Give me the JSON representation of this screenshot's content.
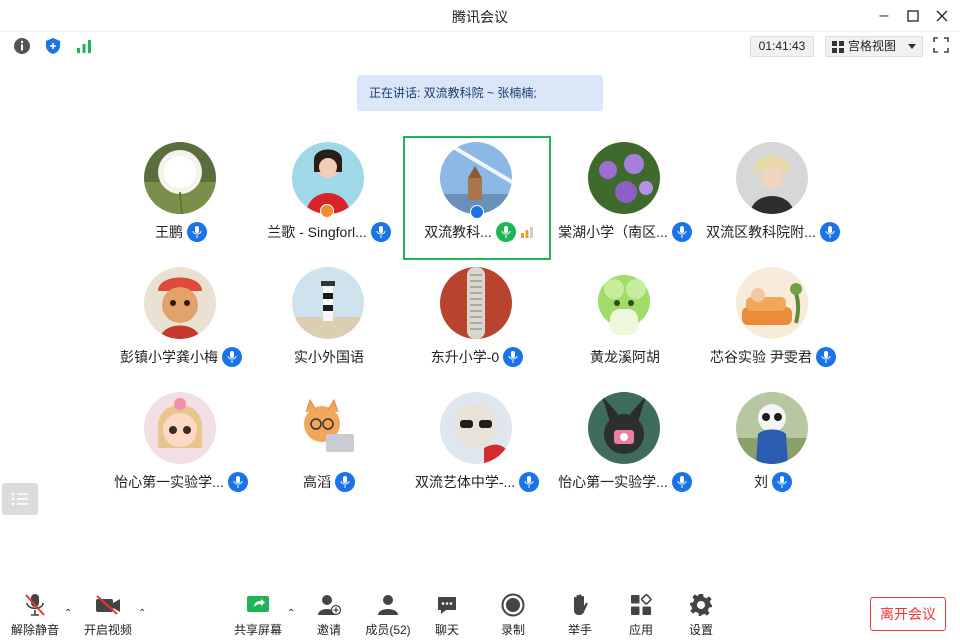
{
  "window": {
    "title": "腾讯会议"
  },
  "toolbar": {
    "timer": "01:41:43",
    "view_label": "宫格视图"
  },
  "banner": {
    "speaking": "正在讲话: 双流教科院 ~ 张楠楠;"
  },
  "participants": [
    {
      "name": "王鹏",
      "avatar": "dandelion",
      "mic": "blue",
      "active": false
    },
    {
      "name": "兰歌 - Singforl...",
      "avatar": "woman-red-dress",
      "mic": "blue",
      "active": false
    },
    {
      "name": "双流教科...",
      "avatar": "tower-sky",
      "mic": "green",
      "active": true
    },
    {
      "name": "棠湖小学（南区...",
      "avatar": "purple-flowers",
      "mic": "blue",
      "active": false
    },
    {
      "name": "双流区教科院附...",
      "avatar": "person-hat",
      "mic": "blue",
      "active": false
    },
    {
      "name": "彭镇小学龚小梅",
      "avatar": "cat-costume",
      "mic": "blue",
      "active": false
    },
    {
      "name": "实小外国语",
      "avatar": "lighthouse",
      "mic": "none",
      "active": false
    },
    {
      "name": "东升小学-0",
      "avatar": "red-gadget",
      "mic": "blue",
      "active": false
    },
    {
      "name": "黄龙溪阿胡",
      "avatar": "cabbage",
      "mic": "none",
      "active": false
    },
    {
      "name": "芯谷实验 尹雯君",
      "avatar": "cartoon-sofa",
      "mic": "blue",
      "active": false
    },
    {
      "name": "怡心第一实验学...",
      "avatar": "doll-girl",
      "mic": "blue",
      "active": false
    },
    {
      "name": "高滔",
      "avatar": "cat-laptop",
      "mic": "blue",
      "active": false
    },
    {
      "name": "双流艺体中学-...",
      "avatar": "dog-sunglasses",
      "mic": "blue",
      "active": false
    },
    {
      "name": "怡心第一实验学...",
      "avatar": "rabbit-camera",
      "mic": "blue",
      "active": false
    },
    {
      "name": "刘",
      "avatar": "panda-costume",
      "mic": "blue",
      "active": false
    }
  ],
  "bottombar": {
    "unmute": "解除静音",
    "start_video": "开启视频",
    "share_screen": "共享屏幕",
    "invite": "邀请",
    "members": "成员(52)",
    "chat": "聊天",
    "record": "录制",
    "raise_hand": "举手",
    "apps": "应用",
    "settings": "设置",
    "leave": "离开会议"
  },
  "colors": {
    "accent": "#1b73e8",
    "active_border": "#1fb556",
    "leave": "#e33333",
    "banner_bg": "#dbe7f8"
  }
}
